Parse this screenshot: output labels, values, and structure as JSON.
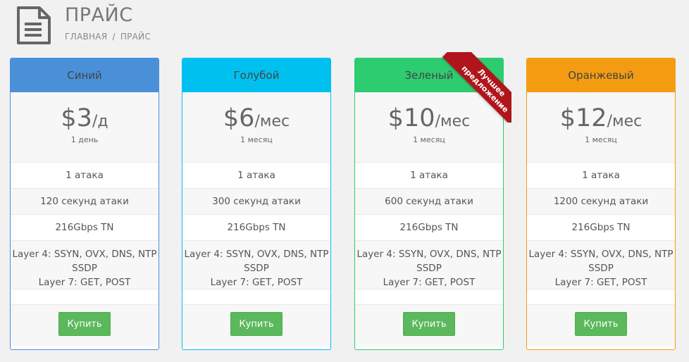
{
  "header": {
    "title": "ПРАЙС",
    "breadcrumb": {
      "home": "ГЛАВНАЯ",
      "separator": "/",
      "current": "ПРАЙС"
    }
  },
  "plans": [
    {
      "name": "Синий",
      "color": "#4a90d9",
      "border": "#4a90d9",
      "price": "$3",
      "unit": "/д",
      "period": "1 день",
      "features": [
        "1 атака",
        "120 секунд атаки",
        "216Gbps TN",
        "Layer 4: SSYN, OVX, DNS, NTP",
        "SSDP",
        "Layer 7: GET, POST"
      ],
      "button": "Купить"
    },
    {
      "name": "Голубой",
      "color": "#00c0ef",
      "border": "#00c0ef",
      "price": "$6",
      "unit": "/мес",
      "period": "1 месяц",
      "features": [
        "1 атака",
        "300 секунд атаки",
        "216Gbps TN",
        "Layer 4: SSYN, OVX, DNS, NTP",
        "SSDP",
        "Layer 7: GET, POST"
      ],
      "button": "Купить"
    },
    {
      "name": "Зеленый",
      "color": "#2ecc71",
      "border": "#2ecc71",
      "price": "$10",
      "unit": "/мес",
      "period": "1 месяц",
      "features": [
        "1 атака",
        "600 секунд атаки",
        "216Gbps TN",
        "Layer 4: SSYN, OVX, DNS, NTP",
        "SSDP",
        "Layer 7: GET, POST"
      ],
      "button": "Купить",
      "ribbon": [
        "Лучшее",
        "предложение"
      ]
    },
    {
      "name": "Оранжевый",
      "color": "#f39c12",
      "border": "#f39c12",
      "price": "$12",
      "unit": "/мес",
      "period": "1 месяц",
      "features": [
        "1 атака",
        "1200 секунд атаки",
        "216Gbps TN",
        "Layer 4: SSYN, OVX, DNS, NTP",
        "SSDP",
        "Layer 7: GET, POST"
      ],
      "button": "Купить"
    }
  ]
}
